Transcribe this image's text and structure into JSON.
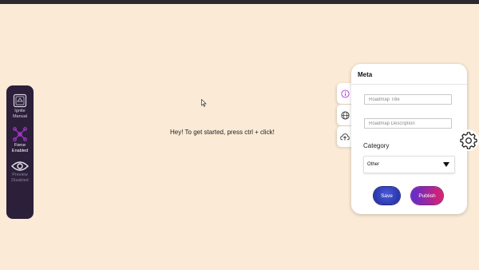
{
  "canvas": {
    "hint": "Hey! To get started, press ctrl + click!"
  },
  "toolbar": {
    "items": [
      {
        "label": "Ignite\nManual",
        "icon": "map-icon"
      },
      {
        "label": "Force\nEnabled",
        "icon": "graph-icon"
      },
      {
        "label": "Preview\nDisabled",
        "icon": "eye-icon"
      }
    ]
  },
  "side_tabs": [
    {
      "icon": "info-icon"
    },
    {
      "icon": "globe-icon"
    },
    {
      "icon": "cloud-upload-icon"
    }
  ],
  "meta": {
    "title": "Meta",
    "title_placeholder": "Roadmap Title",
    "description_placeholder": "Roadmap Description",
    "category_label": "Category",
    "category_value": "Other",
    "save_label": "Save",
    "publish_label": "Publish"
  },
  "settings": {
    "icon": "gear-icon"
  },
  "colors": {
    "background": "#faead6",
    "rail": "#2b1f3a",
    "accent": "#b03ad8",
    "save": "#2a36b8",
    "publish_start": "#5a2fd0",
    "publish_end": "#e0206a"
  }
}
